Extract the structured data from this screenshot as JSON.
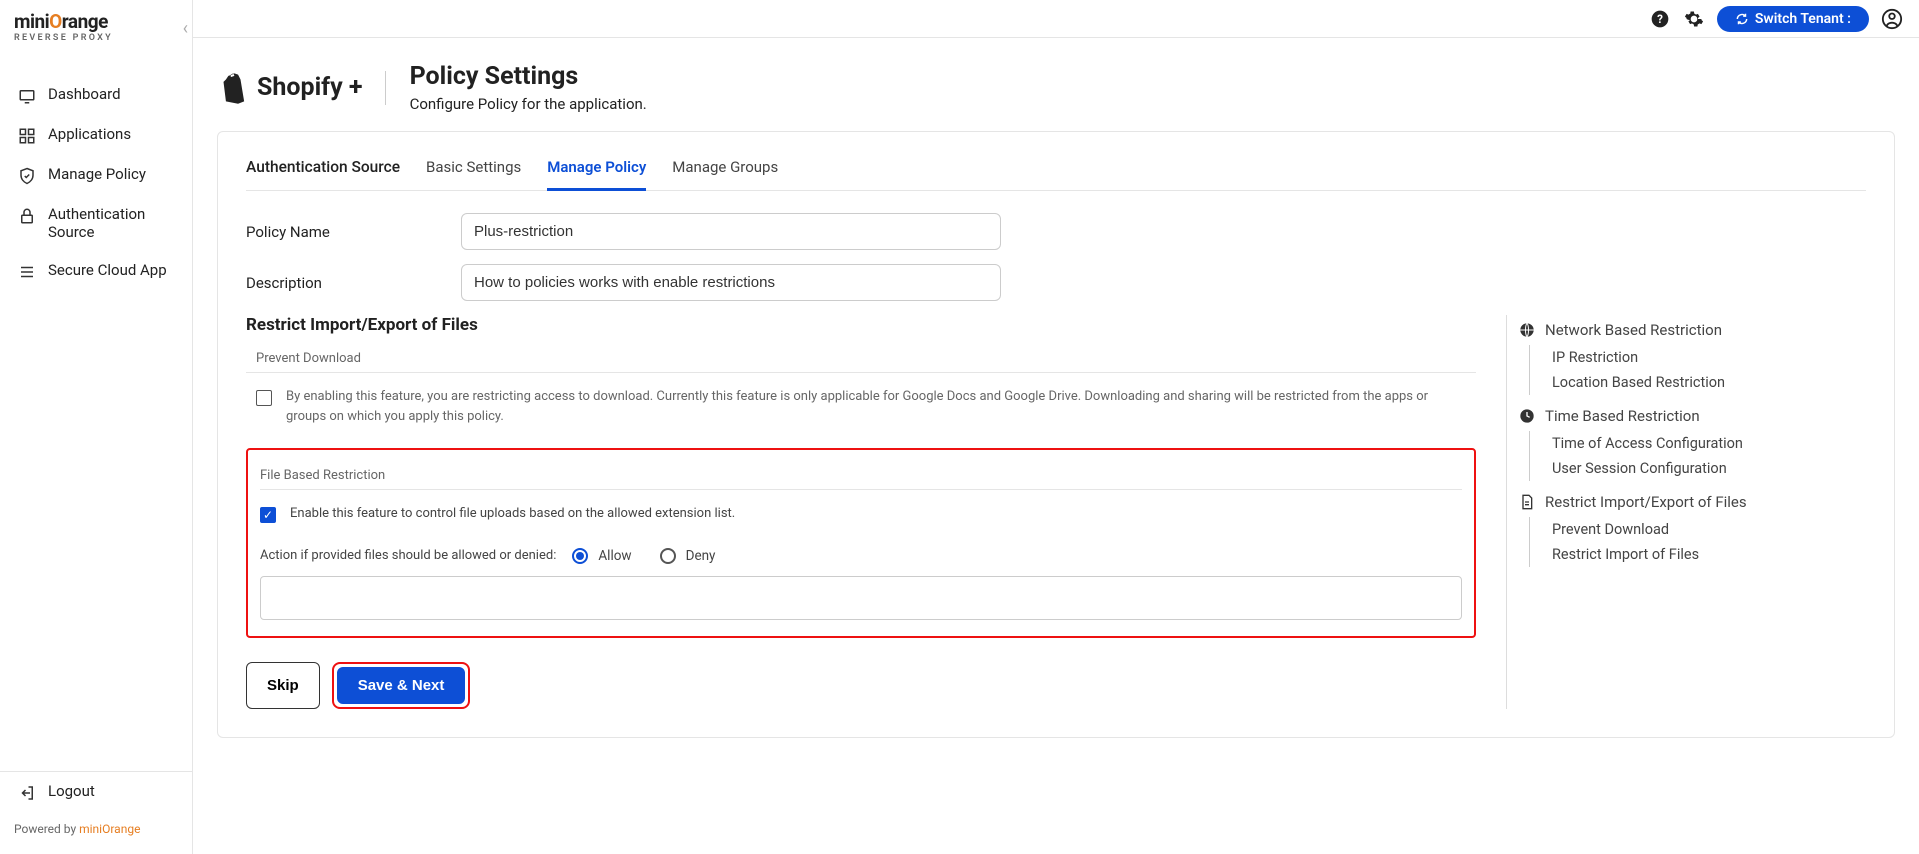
{
  "brand": {
    "name_a": "mini",
    "name_b": "range",
    "sub": "REVERSE PROXY"
  },
  "sidebar": {
    "items": [
      {
        "label": "Dashboard"
      },
      {
        "label": "Applications"
      },
      {
        "label": "Manage Policy"
      },
      {
        "label": "Authentication Source"
      },
      {
        "label": "Secure Cloud App"
      }
    ],
    "logout": "Logout",
    "powered_prefix": "Powered by ",
    "powered_link": "miniOrange"
  },
  "topbar": {
    "switch": "Switch Tenant :"
  },
  "header": {
    "app_name": "Shopify +",
    "title": "Policy Settings",
    "subtitle": "Configure Policy for the application."
  },
  "tabs": [
    {
      "label": "Authentication Source"
    },
    {
      "label": "Basic Settings"
    },
    {
      "label": "Manage Policy"
    },
    {
      "label": "Manage Groups"
    }
  ],
  "form": {
    "policy_name_label": "Policy Name",
    "policy_name_value": "Plus-restriction",
    "description_label": "Description",
    "description_value": "How to policies works with enable restrictions"
  },
  "restrict": {
    "title": "Restrict Import/Export of Files",
    "prevent_label": "Prevent Download",
    "prevent_desc": "By enabling this feature, you are restricting access to download. Currently this feature is only applicable for Google Docs and Google Drive. Downloading and sharing will be restricted from the apps or groups on which you apply this policy.",
    "file_label": "File Based Restriction",
    "file_desc": "Enable this feature to control file uploads based on the allowed extension list.",
    "action_label": "Action if provided files should be allowed or denied:",
    "allow": "Allow",
    "deny": "Deny"
  },
  "actions": {
    "skip": "Skip",
    "save": "Save & Next"
  },
  "rnav": {
    "network": "Network Based Restriction",
    "ip": "IP Restriction",
    "location": "Location Based Restriction",
    "time": "Time Based Restriction",
    "time_access": "Time of Access Configuration",
    "session": "User Session Configuration",
    "restrict": "Restrict Import/Export of Files",
    "prevent": "Prevent Download",
    "restrict_import": "Restrict Import of Files"
  }
}
